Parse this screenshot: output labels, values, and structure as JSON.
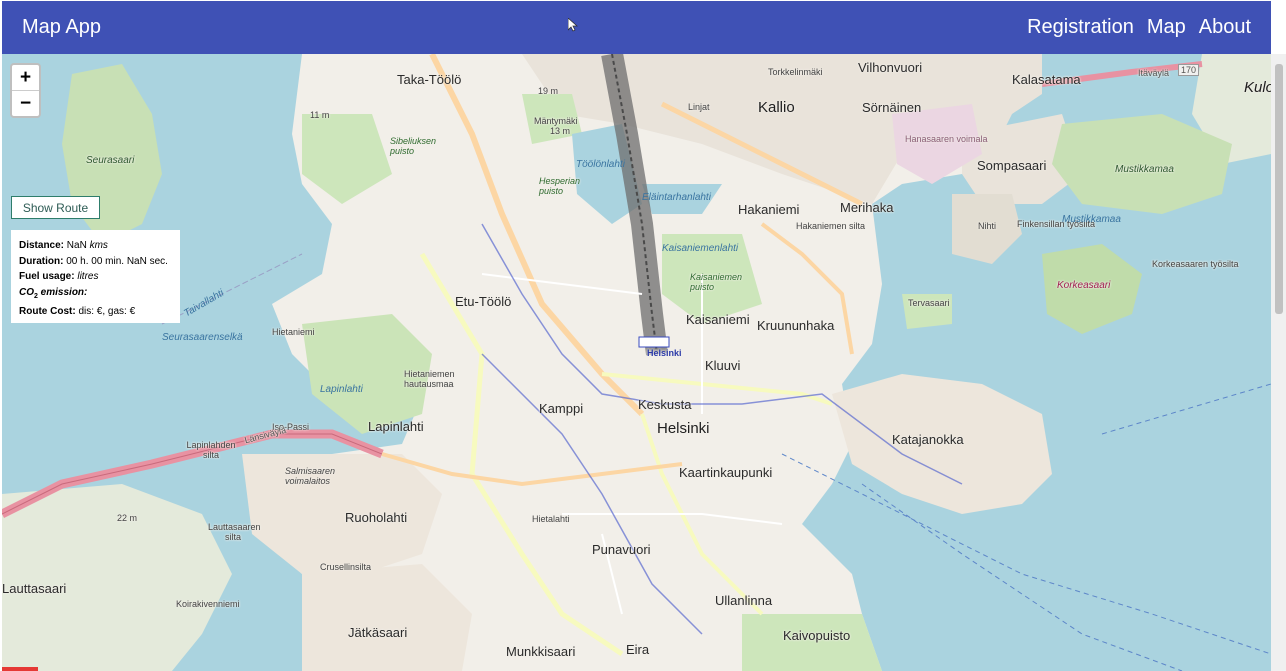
{
  "app": {
    "title": "Map App",
    "nav": [
      "Registration",
      "Map",
      "About"
    ]
  },
  "map_controls": {
    "zoom_in": "+",
    "zoom_out": "−",
    "show_route": "Show Route"
  },
  "route_info": {
    "distance_label": "Distance:",
    "distance_value": "NaN",
    "distance_unit": "kms",
    "duration_label": "Duration:",
    "duration_value": "00 h. 00 min. NaN sec.",
    "fuel_label": "Fuel usage:",
    "fuel_unit": "litres",
    "co2_label_prefix": "CO",
    "co2_subscript": "2",
    "co2_label_suffix": " emission:",
    "cost_label": "Route Cost:",
    "cost_value": "dis: €, gas: €"
  },
  "map_labels": {
    "taka_toolo": "Taka-Töölö",
    "torkkelinmaki": "Torkkelinmäki",
    "vilhonvuori": "Vilhonvuori",
    "kalasatama": "Kalasatama",
    "linjat": "Linjat",
    "kallio": "Kallio",
    "sornainen": "Sörnäinen",
    "hanasaari": "Hanasaaren voimala",
    "sompasaari": "Sompasaari",
    "mustikkamaa": "Mustikkamaa",
    "seurasaari": "Seurasaari",
    "hakaniemi": "Hakaniemi",
    "merihaka": "Merihaka",
    "hakaniemen_silta": "Hakaniemen silta",
    "nihti": "Nihti",
    "finkensillan_tyosilta": "Finkensillan työsilta",
    "korkeasaari": "Korkeasaari",
    "korkeasaaren_silta": "Korkeasaaren työsilta",
    "etu_toolo": "Etu-Töölö",
    "kaisaniemi": "Kaisaniemi",
    "kruununhaka": "Kruununhaka",
    "tervasaari": "Tervasaari",
    "hietaniemi": "Hietaniemi",
    "hietaniemen_hautausmaa": "Hietaniemen hautausmaa",
    "helsinki_station": "Helsinki",
    "kluuvi": "Kluuvi",
    "kamppi": "Kamppi",
    "keskusta": "Keskusta",
    "helsinki": "Helsinki",
    "katajanokka": "Katajanokka",
    "lapinlahti": "Lapinlahti",
    "iso_passi": "Iso-Passi",
    "lapinlahden_silta": "Lapinlahden silta",
    "salmisaari": "Salmisaaren voimalaitos",
    "lauttasaaren_silta": "Lauttasaaren silta",
    "ruoholahti": "Ruoholahti",
    "hietalahti": "Hietalahti",
    "kaartinkaupunki": "Kaartinkaupunki",
    "punavuori": "Punavuori",
    "cruselinsilta": "Crusellinsilta",
    "lauttasaari": "Lauttasaari",
    "koirakivenniemi": "Koirakivenniemi",
    "jatkasaari": "Jätkäsaari",
    "ullanlinna": "Ullanlinna",
    "munkkisaari": "Munkkisaari",
    "eira": "Eira",
    "kaivopuisto": "Kaivopuisto",
    "kulosaari": "Kulos",
    "taivallahti": "Taivallahti",
    "seurasaarenselka": "Seurasaarenselkä",
    "toolonlahti": "Töölönlahti",
    "elaintarhanlahti": "Eläintarhanlahti",
    "kaisaniemenlahti": "Kaisaniemenlahti",
    "kaisaniemen_puisto": "Kaisaniemen puisto",
    "lapinlahti_water": "Lapinlahti",
    "mustikkamaa_water": "Mustikkamaa",
    "itavayla": "Itäväylä",
    "road_170": "170",
    "laivasillankatu": "Länsiväylä",
    "sibelius_puisto": "Sibeliuksen puisto",
    "mantymaki": "Mäntymäki",
    "sm_19": "19 m",
    "sm_22": "22 m",
    "sm_13": "13 m",
    "sm_11": "11 m",
    "hesperian_puisto": "Hesperian puisto",
    "seurasaarenselka_water": "Seurasaarenselkä"
  }
}
